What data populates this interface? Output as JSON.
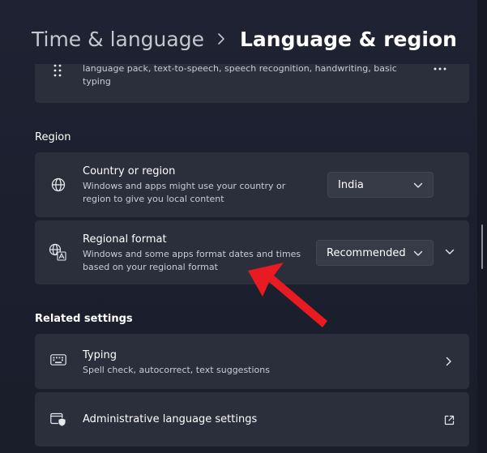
{
  "breadcrumb": {
    "parent": "Time & language",
    "current": "Language & region"
  },
  "language_card": {
    "description_line": "language pack, text-to-speech, speech recognition, handwriting, basic",
    "description_line2": "typing"
  },
  "region": {
    "heading": "Region",
    "country": {
      "title": "Country or region",
      "desc1": "Windows and apps might use your country or",
      "desc2": "region to give you local content",
      "value": "India"
    },
    "format": {
      "title": "Regional format",
      "desc1": "Windows and some apps format dates and times",
      "desc2": "based on your regional format",
      "value": "Recommended"
    }
  },
  "related": {
    "heading": "Related settings",
    "typing": {
      "title": "Typing",
      "desc": "Spell check, autocorrect, text suggestions"
    },
    "admin": {
      "title": "Administrative language settings"
    }
  },
  "icons": {
    "drag": "drag-handle-icon",
    "more": "more-options-icon",
    "globe": "globe-icon",
    "regional_format": "language-format-icon",
    "keyboard": "keyboard-icon",
    "admin": "admin-shield-icon",
    "external": "external-link-icon"
  },
  "colors": {
    "background": "#1c1f2e",
    "card": "#2b2e3b",
    "dropdown": "#373a47",
    "annotation_arrow": "#e81a22"
  }
}
